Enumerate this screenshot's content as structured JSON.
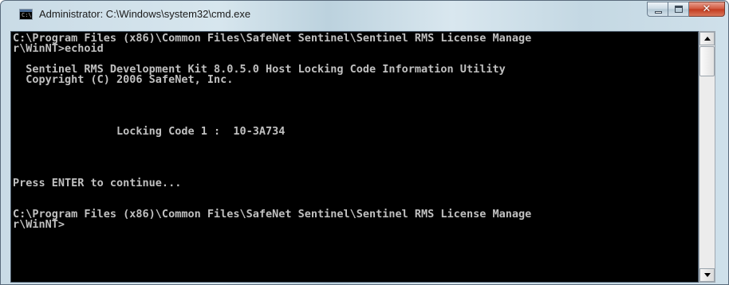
{
  "window": {
    "title": "Administrator: C:\\Windows\\system32\\cmd.exe",
    "app_icon": "cmd-icon",
    "app_icon_text": "C:\\",
    "controls": {
      "minimize_icon": "minimize-icon",
      "maximize_icon": "maximize-icon",
      "close_icon": "close-icon",
      "close_glyph": "✕"
    }
  },
  "console": {
    "background": "#000000",
    "foreground": "#c0c0c0",
    "lines": [
      "C:\\Program Files (x86)\\Common Files\\SafeNet Sentinel\\Sentinel RMS License Manage",
      "r\\WinNT>echoid",
      "",
      "  Sentinel RMS Development Kit 8.0.5.0 Host Locking Code Information Utility",
      "  Copyright (C) 2006 SafeNet, Inc.",
      "",
      "",
      "",
      "",
      "                Locking Code 1 :  10-3A734",
      "",
      "",
      "",
      "",
      "Press ENTER to continue...",
      "",
      "",
      "C:\\Program Files (x86)\\Common Files\\SafeNet Sentinel\\Sentinel RMS License Manage",
      "r\\WinNT>"
    ]
  },
  "scrollbar": {
    "up_icon": "scroll-up-arrow-icon",
    "down_icon": "scroll-down-arrow-icon"
  }
}
